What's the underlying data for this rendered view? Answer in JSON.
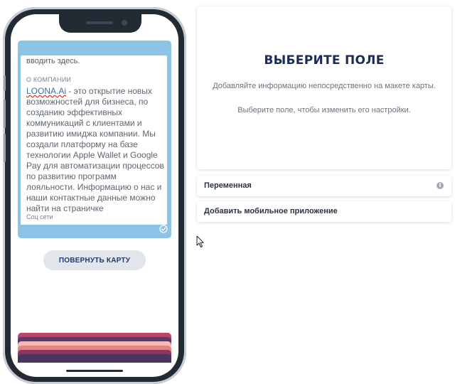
{
  "phone": {
    "card_back": {
      "top_text": "вводить здесь.",
      "about_label": "О КОМПАНИИ",
      "brand_name": "LOONA.Ai",
      "about_text": " - это открытие новых возможностей для бизнеса, по созданию эффективных коммуникаций с клиентами и развитию имиджа компании. Мы создали платформу на базе технологии Apple Wallet и Google Pay для автоматизации процессов по развитию программ лояльности. Информацию о нас и наши контактные данные можно найти на страничке",
      "social_label": "Соц сети",
      "check_icon": "check-circle-icon"
    },
    "flip_button_label": "ПОВЕРНУТЬ КАРТУ",
    "card_stack_colors": [
      "#c2416a",
      "#5b3a67",
      "#f4b9b8",
      "#e3867f",
      "#8f3561",
      "#4a3560"
    ]
  },
  "select_panel": {
    "title": "ВЫБЕРИТЕ ПОЛЕ",
    "hint_add": "Добавляйте информацию непосредственно на макете карты.",
    "hint_select": "Выберите поле, чтобы изменить его настройки."
  },
  "rows": {
    "variable_label": "Переменная",
    "variable_info_icon": "info-icon",
    "add_app_label": "Добавить мобильное приложение"
  },
  "colors": {
    "accent_blue": "#8cc3e6",
    "title_navy": "#1b2d57",
    "button_gray": "#e2e5e9"
  }
}
